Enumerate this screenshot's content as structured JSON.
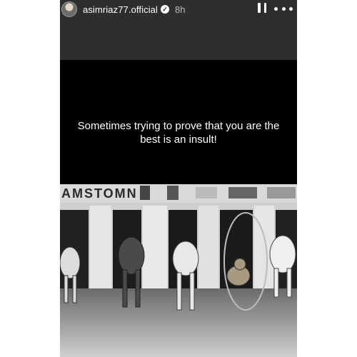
{
  "story": {
    "username": "asimriaz77.official",
    "time": "8h",
    "verified_icon": "verified-check-icon",
    "pause_icon": "pause-icon",
    "more_icon": "more-dots-icon",
    "caption": "Sometimes trying to prove that you are the best is an insult!"
  },
  "photo": {
    "banner_text": "AMSTOMN",
    "description_icon": "greyhound-race-photo"
  },
  "colors": {
    "story_bg": "#2e2e2e",
    "caption_bg": "#000000",
    "text": "#ffffff"
  }
}
